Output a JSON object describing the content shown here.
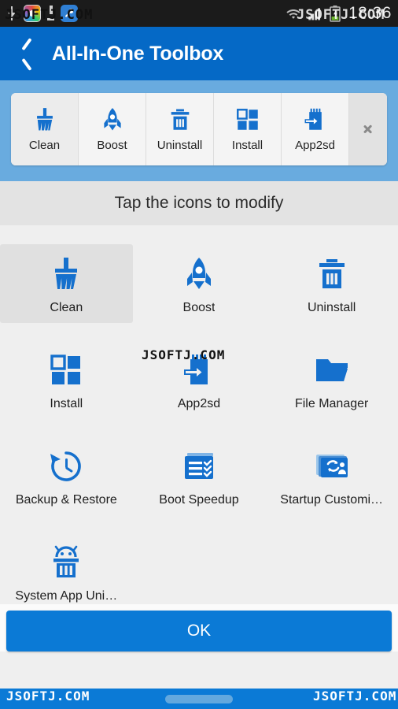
{
  "statusbar": {
    "time": "18:36",
    "left_icons": [
      "download-arrow-icon",
      "photos-app-icon",
      "vibrate-icon",
      "wrench-app-icon"
    ],
    "right_icons": [
      "wifi-icon",
      "signal-icon",
      "battery-icon"
    ]
  },
  "header": {
    "title": "All-In-One Toolbox",
    "back_label": "back-chevron",
    "bg_color": "#0569c6"
  },
  "toolbar": {
    "items": [
      {
        "label": "Clean",
        "icon": "broom-icon",
        "selected": true
      },
      {
        "label": "Boost",
        "icon": "rocket-icon",
        "selected": false
      },
      {
        "label": "Uninstall",
        "icon": "trash-icon",
        "selected": false
      },
      {
        "label": "Install",
        "icon": "grid-apps-icon",
        "selected": false
      },
      {
        "label": "App2sd",
        "icon": "sdcard-icon",
        "selected": false
      }
    ],
    "more_icon": "chevron-right-icon"
  },
  "hint": {
    "text": "Tap the icons to modify"
  },
  "grid": {
    "items": [
      {
        "label": "Clean",
        "icon": "broom-icon",
        "selected": true
      },
      {
        "label": "Boost",
        "icon": "rocket-icon",
        "selected": false
      },
      {
        "label": "Uninstall",
        "icon": "trash-icon",
        "selected": false
      },
      {
        "label": "Install",
        "icon": "grid-apps-icon",
        "selected": false
      },
      {
        "label": "App2sd",
        "icon": "sdcard-icon",
        "selected": false
      },
      {
        "label": "File Manager",
        "icon": "folder-icon",
        "selected": false
      },
      {
        "label": "Backup & Restore",
        "icon": "clock-back-icon",
        "selected": false
      },
      {
        "label": "Boot Speedup",
        "icon": "checklist-icon",
        "selected": false
      },
      {
        "label": "Startup Customi…",
        "icon": "startup-icon",
        "selected": false
      },
      {
        "label": "System App Uni…",
        "icon": "android-trash-icon",
        "selected": false
      }
    ]
  },
  "footer": {
    "ok_label": "OK"
  },
  "watermarks": {
    "status_left": "JSOFTJ.COM",
    "status_right": "JSOFTJ.COM",
    "grid_center": "JSOFTJ.COM",
    "bottom_left": "JSOFTJ.COM",
    "bottom_right": "JSOFTJ.COM"
  },
  "colors": {
    "accent": "#0569c6",
    "band": "#69abdf",
    "icon_blue": "#1570cd",
    "button": "#0b7ad6"
  }
}
